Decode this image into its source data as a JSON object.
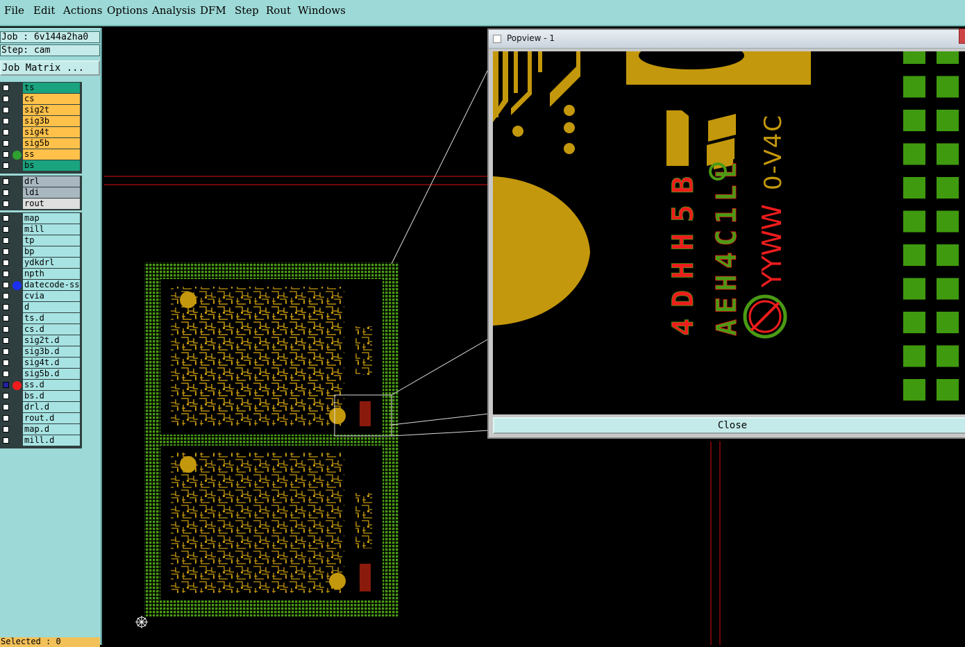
{
  "menu": [
    "File",
    "Edit",
    "Actions",
    "Options",
    "Analysis",
    "DFM",
    "Step",
    "Rout",
    "Windows"
  ],
  "left": {
    "job": "Job : 6v144a2ha0",
    "step": "Step: cam",
    "job_matrix": "Job Matrix ...",
    "selected": "Selected : 0"
  },
  "layers": {
    "board": [
      {
        "name": "ts",
        "color": "#1aa37f",
        "dot": ""
      },
      {
        "name": "cs",
        "color": "#ffc14a",
        "dot": ""
      },
      {
        "name": "sig2t",
        "color": "#ffc14a",
        "dot": ""
      },
      {
        "name": "sig3b",
        "color": "#ffc14a",
        "dot": ""
      },
      {
        "name": "sig4t",
        "color": "#ffc14a",
        "dot": ""
      },
      {
        "name": "sig5b",
        "color": "#ffc14a",
        "dot": ""
      },
      {
        "name": "ss",
        "color": "#ffc14a",
        "dot": "#2fa12f"
      },
      {
        "name": "bs",
        "color": "#1aa37f",
        "dot": ""
      }
    ],
    "drill": [
      {
        "name": "drl",
        "color": "#a9b7c0",
        "dot": ""
      },
      {
        "name": "ldi",
        "color": "#a9b7c0",
        "dot": ""
      },
      {
        "name": "rout",
        "color": "#dedede",
        "dot": ""
      }
    ],
    "misc": [
      {
        "name": "map",
        "color": "#a7e3e3",
        "dot": ""
      },
      {
        "name": "mill",
        "color": "#a7e3e3",
        "dot": ""
      },
      {
        "name": "tp",
        "color": "#a7e3e3",
        "dot": ""
      },
      {
        "name": "bp",
        "color": "#a7e3e3",
        "dot": ""
      },
      {
        "name": "ydkdrl",
        "color": "#a7e3e3",
        "dot": ""
      },
      {
        "name": "npth",
        "color": "#a7e3e3",
        "dot": ""
      },
      {
        "name": "datecode-ss",
        "color": "#a7e3e3",
        "dot": "#1a2ff0"
      },
      {
        "name": "cvia",
        "color": "#a7e3e3",
        "dot": ""
      },
      {
        "name": "d",
        "color": "#a7e3e3",
        "dot": ""
      },
      {
        "name": "ts.d",
        "color": "#a7e3e3",
        "dot": ""
      },
      {
        "name": "cs.d",
        "color": "#a7e3e3",
        "dot": ""
      },
      {
        "name": "sig2t.d",
        "color": "#a7e3e3",
        "dot": ""
      },
      {
        "name": "sig3b.d",
        "color": "#a7e3e3",
        "dot": ""
      },
      {
        "name": "sig4t.d",
        "color": "#a7e3e3",
        "dot": ""
      },
      {
        "name": "sig5b.d",
        "color": "#a7e3e3",
        "dot": ""
      },
      {
        "name": "ss.d",
        "color": "#a7e3e3",
        "dot": "#ee1c1c",
        "checked": true,
        "mark": true
      },
      {
        "name": "bs.d",
        "color": "#a7e3e3",
        "dot": ""
      },
      {
        "name": "drl.d",
        "color": "#a7e3e3",
        "dot": ""
      },
      {
        "name": "rout.d",
        "color": "#a7e3e3",
        "dot": ""
      },
      {
        "name": "map.d",
        "color": "#a7e3e3",
        "dot": ""
      },
      {
        "name": "mill.d",
        "color": "#a7e3e3",
        "dot": ""
      }
    ]
  },
  "popview": {
    "title": "Popview - 1",
    "close_label": "Close",
    "silkscreen_text": {
      "code1": "4DHH5B",
      "code2": "AEH4C1LL",
      "date_code": "YYWW",
      "version": "0-V4C"
    }
  },
  "colors": {
    "copper": "#c4980c",
    "silk_green": "#4a9a14",
    "silk_red": "#ee1c1c",
    "pad_green": "#3f9a0f",
    "panel_bg": "#9dd9d6"
  }
}
